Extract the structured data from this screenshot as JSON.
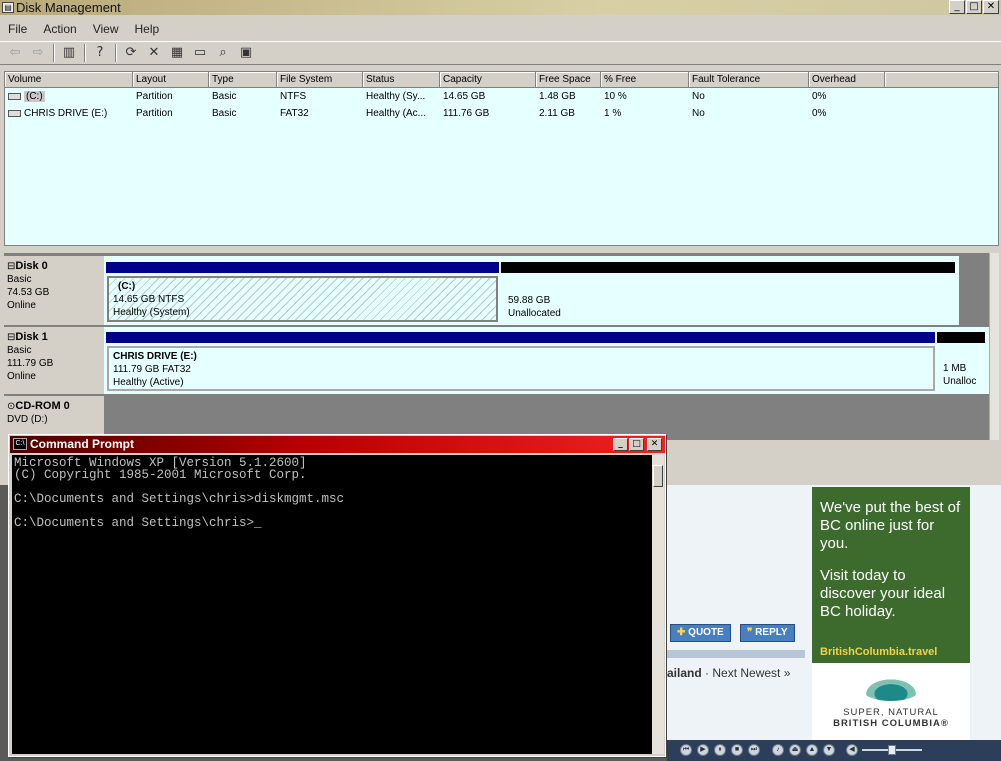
{
  "disk_mgmt": {
    "title": "Disk Management",
    "menu": [
      "File",
      "Action",
      "View",
      "Help"
    ],
    "columns": [
      "Volume",
      "Layout",
      "Type",
      "File System",
      "Status",
      "Capacity",
      "Free Space",
      "% Free",
      "Fault Tolerance",
      "Overhead"
    ],
    "volumes": [
      {
        "volume": "(C:)",
        "layout": "Partition",
        "type": "Basic",
        "fs": "NTFS",
        "status": "Healthy (Sy...",
        "capacity": "14.65 GB",
        "free": "1.48 GB",
        "pct": "10 %",
        "fault": "No",
        "overhead": "0%"
      },
      {
        "volume": "CHRIS DRIVE (E:)",
        "layout": "Partition",
        "type": "Basic",
        "fs": "FAT32",
        "status": "Healthy (Ac...",
        "capacity": "111.76 GB",
        "free": "2.11 GB",
        "pct": "1 %",
        "fault": "No",
        "overhead": "0%"
      }
    ],
    "disks": [
      {
        "name": "Disk 0",
        "type": "Basic",
        "size": "74.53 GB",
        "state": "Online",
        "p1_name": "(C:)",
        "p1_size": "14.65 GB NTFS",
        "p1_status": "Healthy (System)",
        "p2_size": "59.88 GB",
        "p2_status": "Unallocated"
      },
      {
        "name": "Disk 1",
        "type": "Basic",
        "size": "111.79 GB",
        "state": "Online",
        "p1_name": "CHRIS DRIVE  (E:)",
        "p1_size": "111.79 GB FAT32",
        "p1_status": "Healthy (Active)",
        "p2_size": "1 MB",
        "p2_status": "Unalloc"
      },
      {
        "name": "CD-ROM 0",
        "type": "DVD (D:)"
      }
    ]
  },
  "cmd": {
    "title": "Command Prompt",
    "icon_text": "C:\\",
    "lines": [
      "Microsoft Windows XP [Version 5.1.2600]",
      "(C) Copyright 1985-2001 Microsoft Corp.",
      "",
      "C:\\Documents and Settings\\chris>diskmgmt.msc",
      "",
      "C:\\Documents and Settings\\chris>_"
    ]
  },
  "web": {
    "ad_text_1": "We've put the best of BC online just for you.",
    "ad_text_2": "Visit today to discover your ideal BC holiday.",
    "ad_link": "BritishColumbia.travel",
    "ad_brand_1": "SUPER, NATURAL",
    "ad_brand_2": "BRITISH COLUMBIA®",
    "quote_label": "QUOTE",
    "reply_label": "REPLY",
    "nav_text_1": "ailand",
    "nav_text_2": "· Next Newest »"
  },
  "colors": {
    "volume_bg": "#e6ffff",
    "partition_bar": "#00008b",
    "cmd_title": "#b80000",
    "ad_green": "#3c6b2d"
  }
}
